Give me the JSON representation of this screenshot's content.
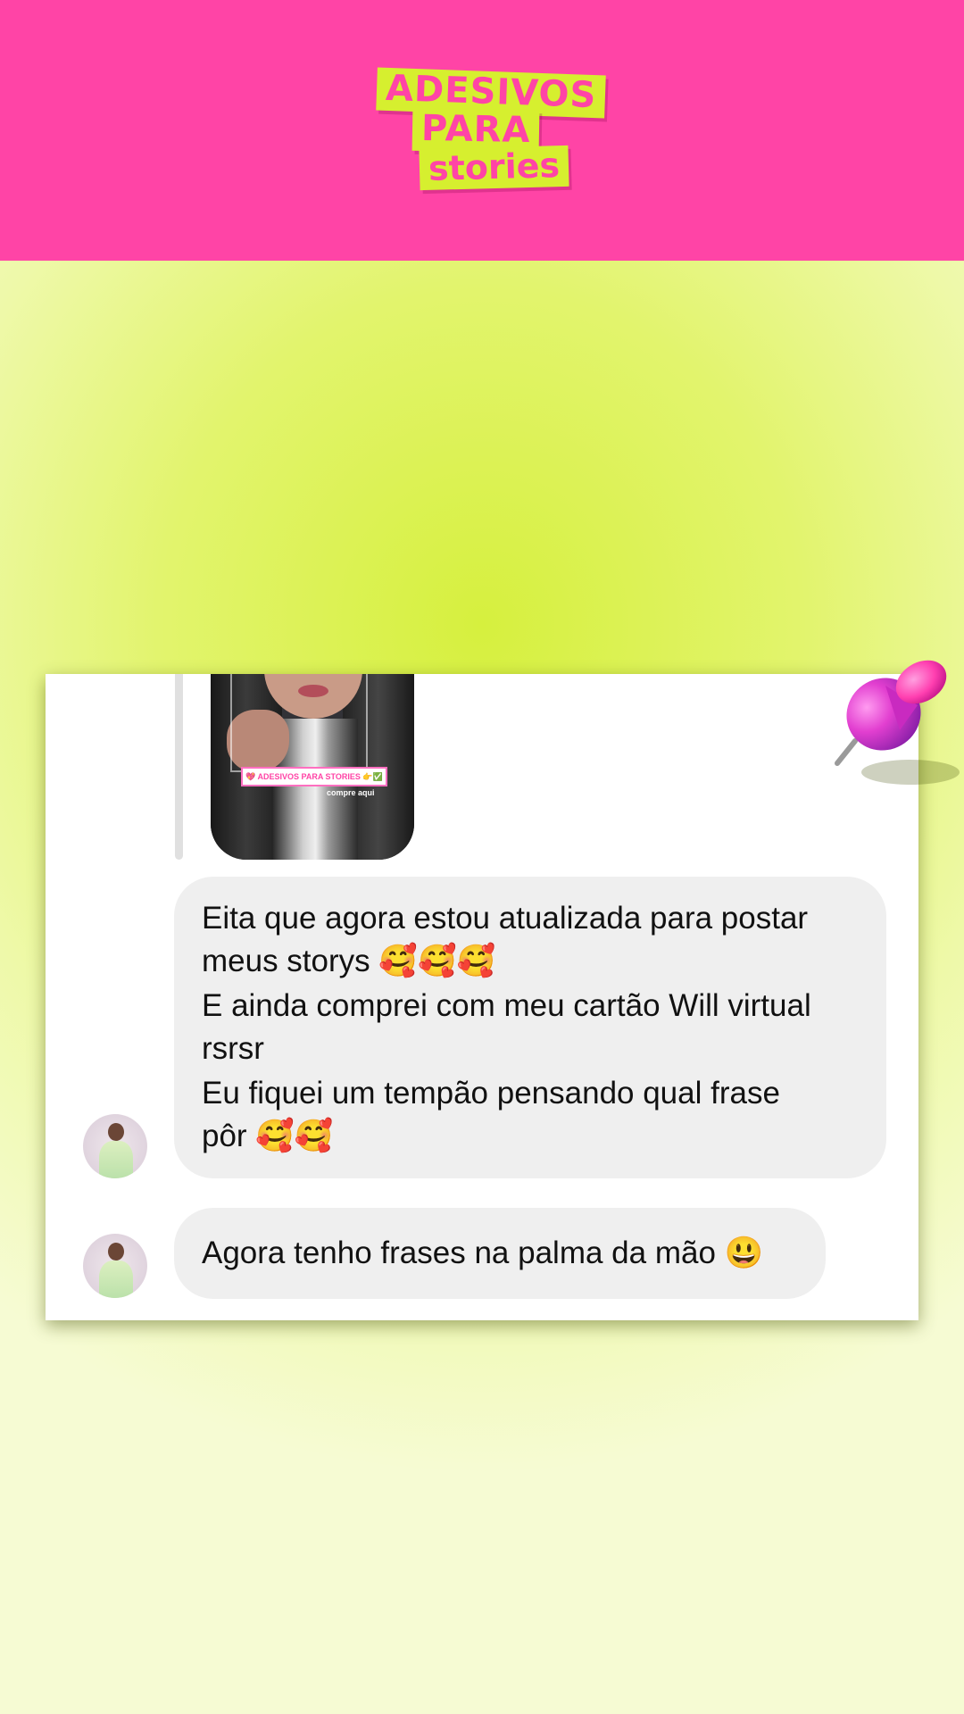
{
  "header": {
    "brand_color": "#ff44a6",
    "accent_color": "#d6ef2f",
    "logo": {
      "line1": "ADESIVOS",
      "line2": "PARA",
      "line3": "stories"
    }
  },
  "background": {
    "gradient_center": "#d6f03e",
    "gradient_edge": "#f6fbd3"
  },
  "chat": {
    "replied_story": {
      "sticker_text": "💖 ADESIVOS PARA STORIES 👉✅",
      "sticker_cta": "compre aqui"
    },
    "messages": [
      {
        "lines": [
          "Eita que agora estou atualizada para postar",
          "meus storys 🥰🥰🥰",
          "E ainda comprei com meu cartão Will virtual",
          "rsrsr",
          "Eu fiquei um tempão pensando qual frase",
          "pôr 🥰🥰"
        ]
      },
      {
        "text": "Agora tenho frases na palma da mão 😃"
      }
    ],
    "bubble_color": "#efefef"
  },
  "decor": {
    "pin_icon": "pushpin-icon",
    "pin_color": "#e23fd0"
  }
}
